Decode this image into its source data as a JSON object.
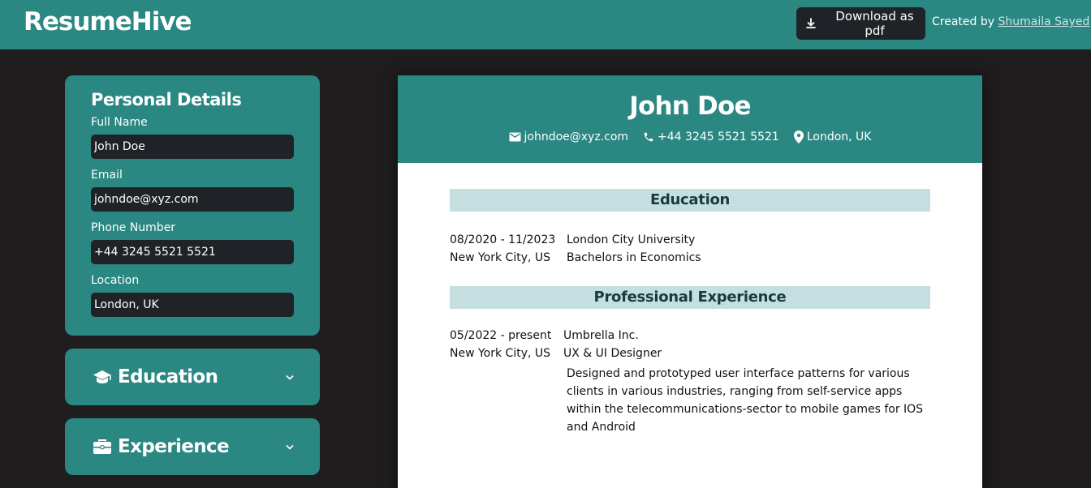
{
  "header": {
    "brand": "ResumeHive",
    "download_label": "Download as pdf",
    "credit_prefix": "Created by",
    "credit_author": "Shumaila Sayed"
  },
  "personal": {
    "title": "Personal Details",
    "fields": [
      {
        "label": "Full Name",
        "value": "John Doe"
      },
      {
        "label": "Email",
        "value": "johndoe@xyz.com"
      },
      {
        "label": "Phone Number",
        "value": "+44 3245 5521 5521"
      },
      {
        "label": "Location",
        "value": "London, UK"
      }
    ]
  },
  "panels": {
    "education": "Education",
    "experience": "Experience"
  },
  "resume": {
    "name": "John Doe",
    "email": "johndoe@xyz.com",
    "phone": "+44 3245 5521 5521",
    "location": "London, UK",
    "education": {
      "title": "Education",
      "entries": [
        {
          "dates": "08/2020 - 11/2023",
          "place": "New York City, US",
          "org": "London City University",
          "role": "Bachelors in Economics"
        }
      ]
    },
    "experience": {
      "title": "Professional Experience",
      "entries": [
        {
          "dates": "05/2022 - present",
          "place": "New York City, US",
          "org": "Umbrella Inc.",
          "role": "UX & UI Designer",
          "description": "Designed and prototyped user interface patterns for various clients in various industries, ranging from self-service apps within the telecommunications-sector to mobile games for IOS and Android"
        }
      ]
    }
  },
  "colors": {
    "teal": "#2a8782",
    "background": "#1f1d1e",
    "input_bg": "#1f2327",
    "section_bar": "#c5dfe0"
  }
}
